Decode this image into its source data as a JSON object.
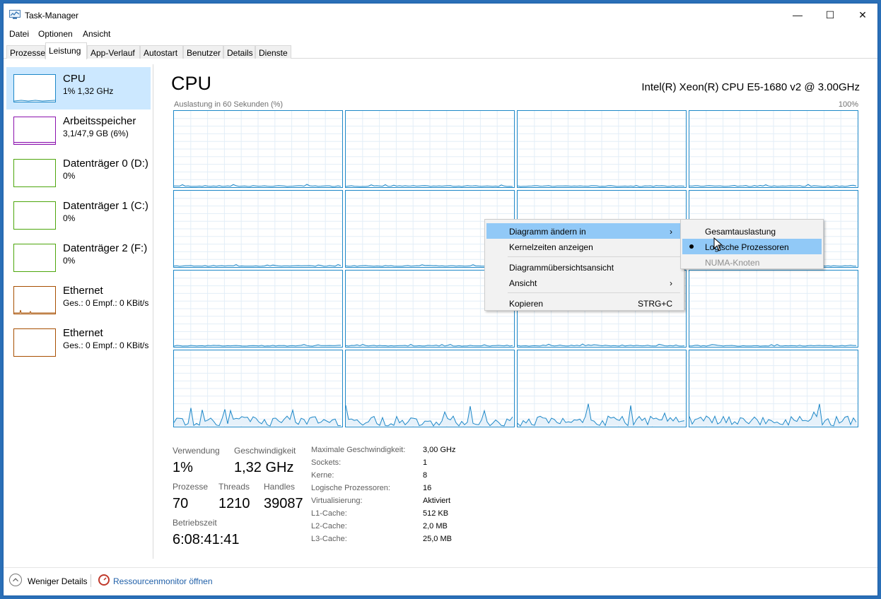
{
  "window": {
    "title": "Task-Manager",
    "controls": {
      "minimize": "—",
      "maximize": "☐",
      "close": "✕"
    }
  },
  "menu": [
    "Datei",
    "Optionen",
    "Ansicht"
  ],
  "tabs": [
    "Prozesse",
    "Leistung",
    "App-Verlauf",
    "Autostart",
    "Benutzer",
    "Details",
    "Dienste"
  ],
  "active_tab": "Leistung",
  "sidebar": [
    {
      "name": "CPU",
      "sub": "1% 1,32 GHz",
      "color": "#1e88c8",
      "selected": true
    },
    {
      "name": "Arbeitsspeicher",
      "sub": "3,1/47,9 GB (6%)",
      "color": "#8b12ae"
    },
    {
      "name": "Datenträger 0 (D:)",
      "sub": "0%",
      "color": "#4da60c"
    },
    {
      "name": "Datenträger 1 (C:)",
      "sub": "0%",
      "color": "#4da60c"
    },
    {
      "name": "Datenträger 2 (F:)",
      "sub": "0%",
      "color": "#4da60c"
    },
    {
      "name": "Ethernet",
      "sub": "Ges.: 0 Empf.: 0 KBit/s",
      "color": "#a74f01"
    },
    {
      "name": "Ethernet",
      "sub": "Ges.: 0 Empf.: 0 KBit/s",
      "color": "#a74f01"
    }
  ],
  "main": {
    "title": "CPU",
    "cpu_model": "Intel(R) Xeon(R) CPU E5-1680 v2 @ 3.00GHz",
    "chart_label": "Auslastung in 60 Sekunden (%)",
    "chart_max": "100%",
    "graph_color": "#1e88c8"
  },
  "stats": {
    "usage_label": "Verwendung",
    "usage": "1%",
    "speed_label": "Geschwindigkeit",
    "speed": "1,32 GHz",
    "processes_label": "Prozesse",
    "processes": "70",
    "threads_label": "Threads",
    "threads": "1210",
    "handles_label": "Handles",
    "handles": "39087",
    "uptime_label": "Betriebszeit",
    "uptime": "6:08:41:41"
  },
  "details": [
    {
      "label": "Maximale Geschwindigkeit:",
      "value": "3,00 GHz"
    },
    {
      "label": "Sockets:",
      "value": "1"
    },
    {
      "label": "Kerne:",
      "value": "8"
    },
    {
      "label": "Logische Prozessoren:",
      "value": "16"
    },
    {
      "label": "Virtualisierung:",
      "value": "Aktiviert"
    },
    {
      "label": "L1-Cache:",
      "value": "512 KB"
    },
    {
      "label": "L2-Cache:",
      "value": "2,0 MB"
    },
    {
      "label": "L3-Cache:",
      "value": "25,0 MB"
    }
  ],
  "footer": {
    "less_details": "Weniger Details",
    "resource_monitor": "Ressourcenmonitor öffnen"
  },
  "context_menu": {
    "change_graph": "Diagramm ändern in",
    "kernel_times": "Kernelzeiten anzeigen",
    "summary_view": "Diagrammübersichtsansicht",
    "view": "Ansicht",
    "copy": "Kopieren",
    "copy_shortcut": "STRG+C",
    "submenu_arrow": "›"
  },
  "submenu": {
    "overall": "Gesamtauslastung",
    "logical": "Logische Prozessoren",
    "numa": "NUMA-Knoten",
    "selected": "Logische Prozessoren"
  }
}
